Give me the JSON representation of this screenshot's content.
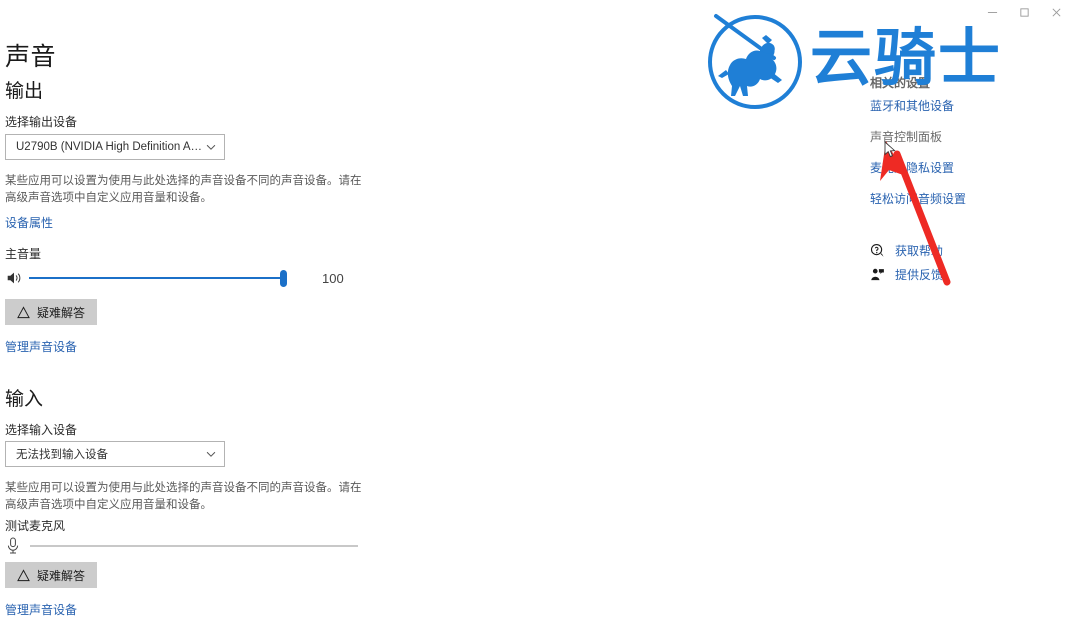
{
  "window": {
    "controls": [
      {
        "name": "minimize",
        "glyph": "minimize-icon"
      },
      {
        "name": "maximize",
        "glyph": "maximize-icon"
      },
      {
        "name": "close",
        "glyph": "close-icon"
      }
    ]
  },
  "page": {
    "title": "声音"
  },
  "output": {
    "heading": "输出",
    "device_label": "选择输出设备",
    "device_value": "U2790B (NVIDIA High Definition Au...",
    "description": "某些应用可以设置为使用与此处选择的声音设备不同的声音设备。请在高级声音选项中自定义应用音量和设备。",
    "device_properties_link": "设备属性",
    "volume_label": "主音量",
    "volume_value": "100",
    "volume_percent": 100,
    "troubleshoot_label": "疑难解答",
    "manage_devices_link": "管理声音设备"
  },
  "input": {
    "heading": "输入",
    "device_label": "选择输入设备",
    "device_value": "无法找到输入设备",
    "description": "某些应用可以设置为使用与此处选择的声音设备不同的声音设备。请在高级声音选项中自定义应用音量和设备。",
    "mic_test_label": "测试麦克风",
    "mic_level_percent": 0,
    "troubleshoot_label": "疑难解答",
    "manage_devices_link": "管理声音设备"
  },
  "related": {
    "heading": "相关的设置",
    "links": [
      {
        "label": "蓝牙和其他设备",
        "state": "normal"
      },
      {
        "label": "声音控制面板",
        "state": "muted"
      },
      {
        "label": "麦克风隐私设置",
        "state": "normal"
      },
      {
        "label": "轻松访问音频设置",
        "state": "normal"
      }
    ],
    "help": [
      {
        "label": "获取帮助",
        "icon": "help-question-icon"
      },
      {
        "label": "提供反馈",
        "icon": "feedback-person-icon"
      }
    ]
  },
  "branding": {
    "wordmark": "云骑士",
    "mark_name": "knight-on-horse-logo"
  },
  "colors": {
    "accent": "#1b70c8",
    "link": "#2a63b0",
    "brand_blue": "#1f7fd6",
    "annotation_red": "#ee2a24",
    "button_gray": "#cccccc"
  }
}
